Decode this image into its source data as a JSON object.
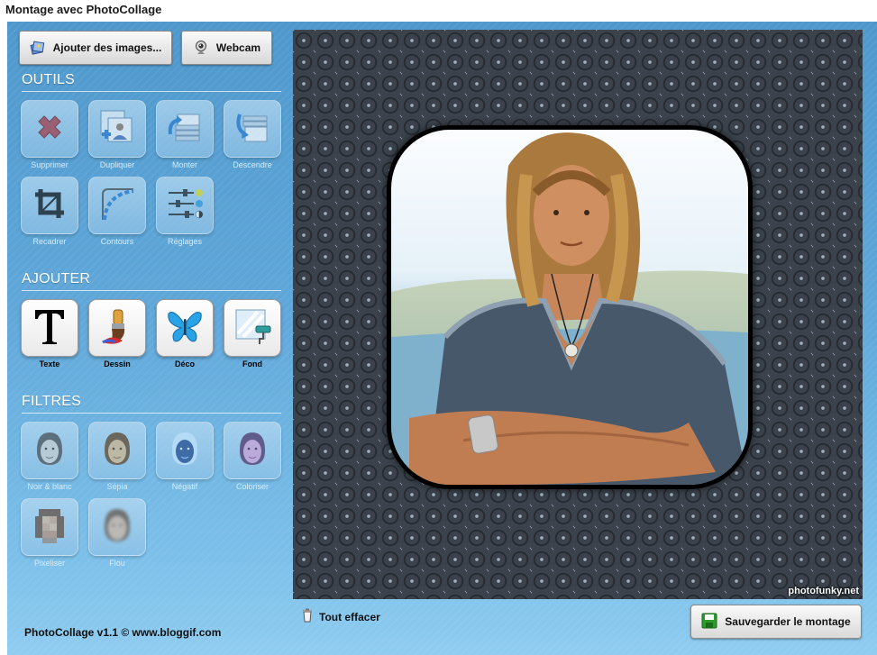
{
  "page_title": "Montage avec PhotoCollage",
  "toolbar": {
    "add_images_label": "Ajouter des images...",
    "add_images_icon": "images-stack-icon",
    "webcam_label": "Webcam",
    "webcam_icon": "webcam-icon"
  },
  "sections": {
    "outils": "OUTILS",
    "ajouter": "AJOUTER",
    "filtres": "FILTRES"
  },
  "outils": [
    {
      "label": "Supprimer",
      "icon": "delete-x-icon"
    },
    {
      "label": "Dupliquer",
      "icon": "duplicate-icon"
    },
    {
      "label": "Monter",
      "icon": "move-up-icon"
    },
    {
      "label": "Descendre",
      "icon": "move-down-icon"
    },
    {
      "label": "Recadrer",
      "icon": "crop-icon"
    },
    {
      "label": "Contours",
      "icon": "rounded-corner-icon"
    },
    {
      "label": "Réglages",
      "icon": "sliders-icon"
    }
  ],
  "ajouter": [
    {
      "label": "Texte",
      "icon": "text-t-icon"
    },
    {
      "label": "Dessin",
      "icon": "paint-brush-icon"
    },
    {
      "label": "Déco",
      "icon": "butterfly-icon"
    },
    {
      "label": "Fond",
      "icon": "background-roller-icon"
    }
  ],
  "filtres": [
    {
      "label": "Noir & blanc",
      "icon": "face-bw-icon"
    },
    {
      "label": "Sépia",
      "icon": "face-sepia-icon"
    },
    {
      "label": "Négatif",
      "icon": "face-negative-icon"
    },
    {
      "label": "Coloriser",
      "icon": "face-colorize-icon"
    },
    {
      "label": "Pixeliser",
      "icon": "face-pixelate-icon"
    },
    {
      "label": "Flou",
      "icon": "face-blur-icon"
    }
  ],
  "canvas": {
    "watermark": "photofunky.net"
  },
  "actions": {
    "clear_label": "Tout effacer",
    "save_label": "Sauvegarder le montage"
  },
  "footer": "PhotoCollage v1.1 © www.bloggif.com",
  "colors": {
    "panel_blue": "#5fa7d9",
    "save_green": "#2c9b2c",
    "delete_red": "#b5474f"
  }
}
